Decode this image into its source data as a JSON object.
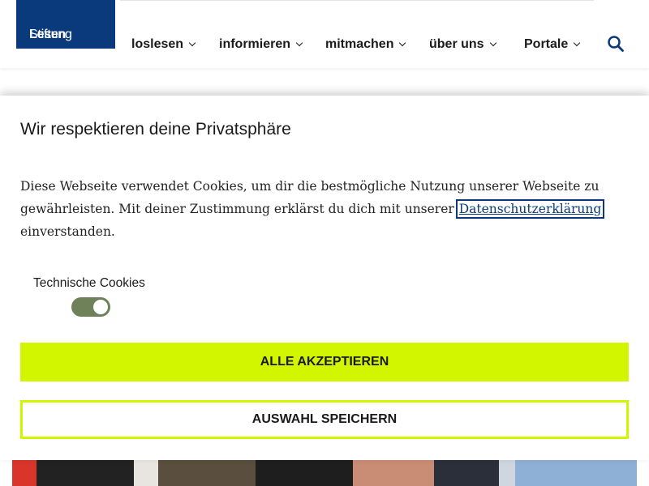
{
  "brand": {
    "logo_part1": "Stiftung",
    "logo_part2": "Lesen",
    "colors": {
      "brand_blue": "#0a3a7c",
      "accent_lime": "#d2f500",
      "toggle_green": "#6e8158"
    }
  },
  "nav": {
    "items": [
      {
        "label": "loslesen",
        "icon": "chevron-down-icon"
      },
      {
        "label": "informieren",
        "icon": "chevron-down-icon"
      },
      {
        "label": "mitmachen",
        "icon": "chevron-down-icon"
      },
      {
        "label": "über uns",
        "icon": "chevron-down-icon"
      },
      {
        "label": "Portale",
        "icon": "chevron-down-icon"
      }
    ],
    "search_icon": "search-icon"
  },
  "cookie_dialog": {
    "title": "Wir respektieren deine Privatsphäre",
    "text_before_link": "Diese Webseite verwendet Cookies, um dir die bestmögliche Nutzung unserer Webseite zu gewährleisten. Mit deiner Zustimmung erklärst du dich mit unserer ",
    "link_label": "Datenschutzerklärung",
    "text_after_link": " einverstanden.",
    "technical_cookies_label": "Technische Cookies",
    "technical_cookies_enabled": true,
    "accept_all_label": "ALLE AKZEPTIEREN",
    "save_selection_label": "AUSWAHL SPEICHERN"
  }
}
